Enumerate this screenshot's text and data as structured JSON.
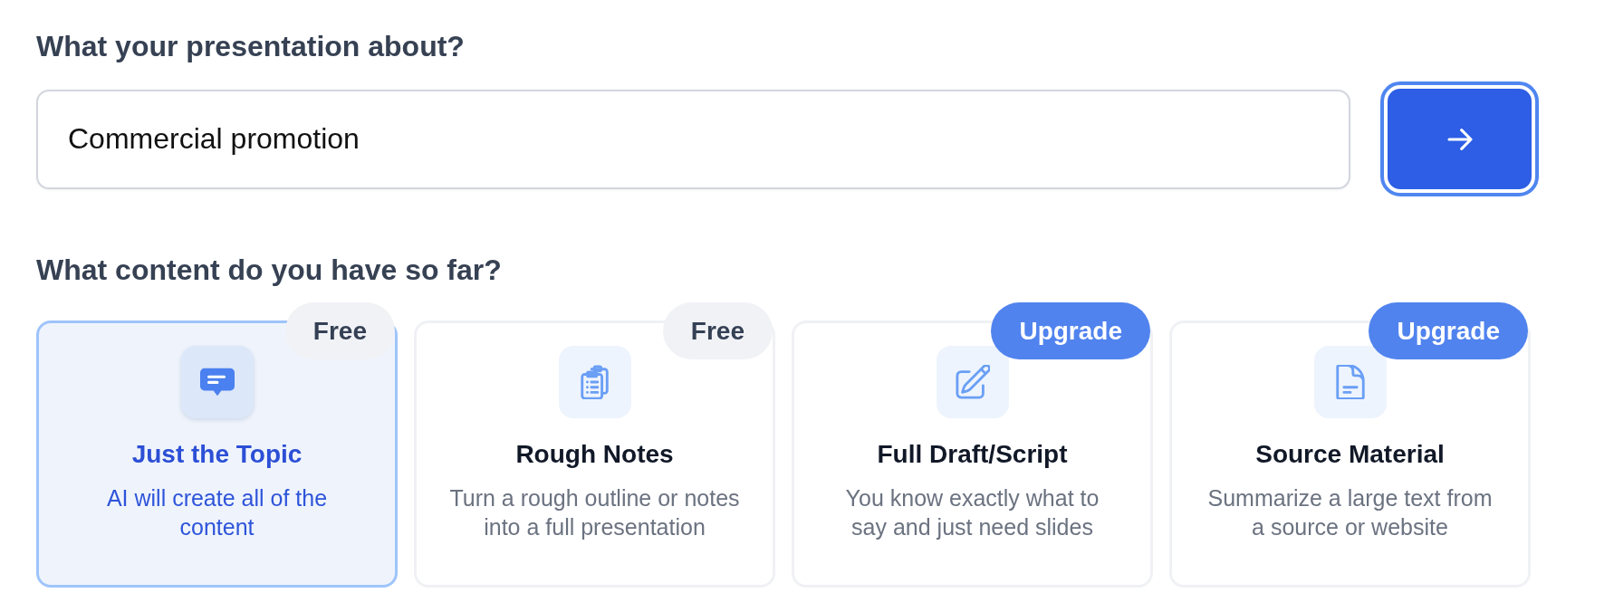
{
  "topic_question": {
    "label": "What your presentation about?"
  },
  "topic_field": {
    "value": "Commercial promotion"
  },
  "submit_button": {
    "focused": true
  },
  "content_question": {
    "label": "What content do you have so far?"
  },
  "content_options": [
    {
      "title": "Just the Topic",
      "description": "AI will create all of the content",
      "badge": {
        "text": "Free",
        "kind": "free"
      },
      "selected": true
    },
    {
      "title": "Rough Notes",
      "description": "Turn a rough outline or notes into a full presentation",
      "badge": {
        "text": "Free",
        "kind": "free"
      },
      "selected": false
    },
    {
      "title": "Full Draft/Script",
      "description": "You know exactly what to say and just need slides",
      "badge": {
        "text": "Upgrade",
        "kind": "upgrade"
      },
      "selected": false
    },
    {
      "title": "Source Material",
      "description": "Summarize a large text from a source or website",
      "badge": {
        "text": "Upgrade",
        "kind": "upgrade"
      },
      "selected": false
    }
  ]
}
